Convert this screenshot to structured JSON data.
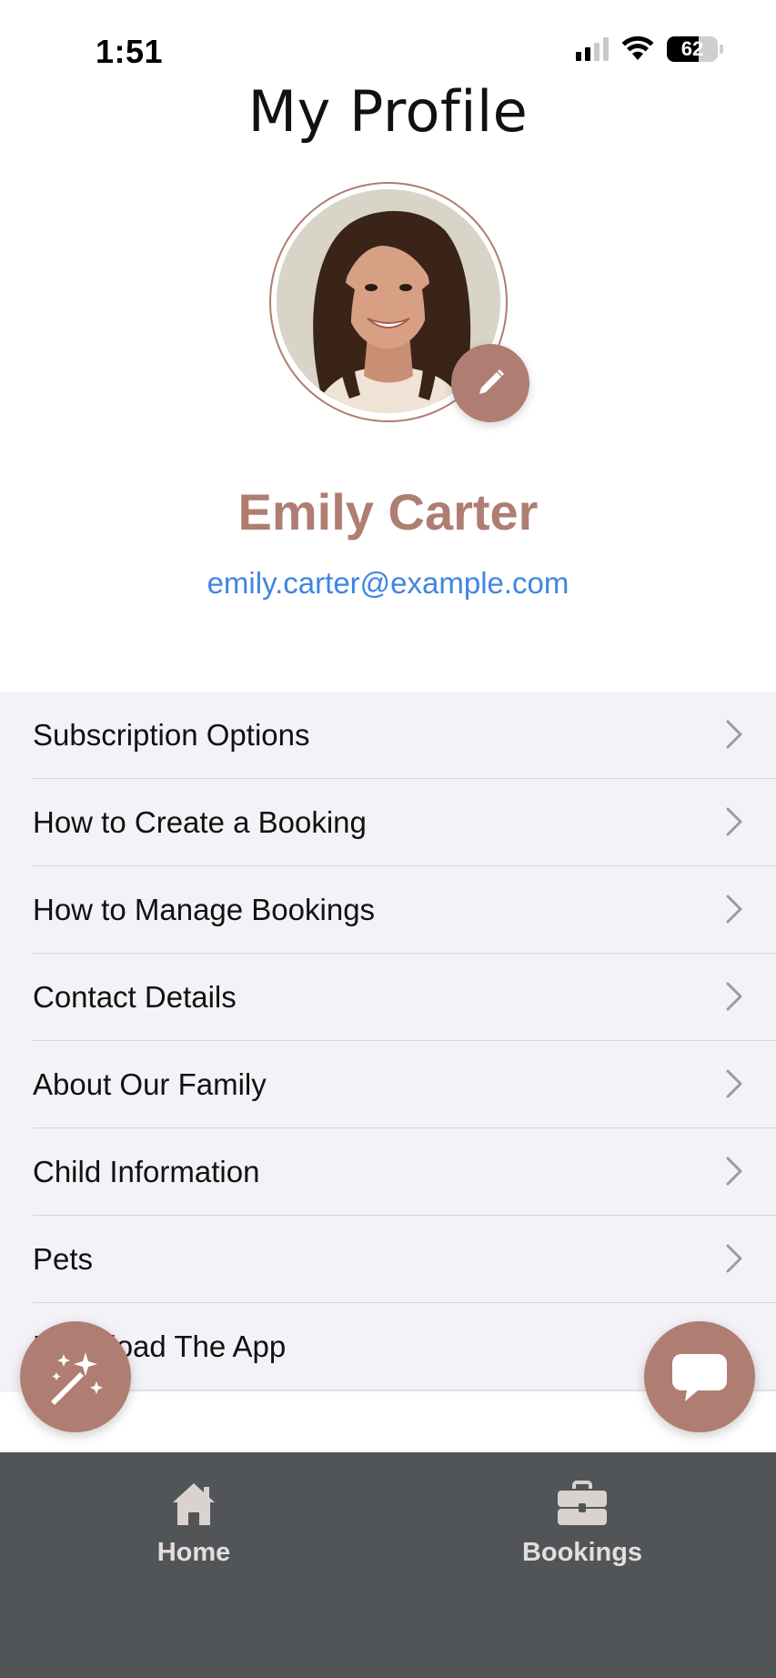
{
  "status_bar": {
    "time": "1:51",
    "battery_level": "62",
    "battery_fraction": 0.62,
    "icons": [
      "signal-icon",
      "wifi-icon",
      "battery-icon"
    ]
  },
  "header": {
    "title": "My Profile"
  },
  "profile": {
    "name": "Emily Carter",
    "email": "emily.carter@example.com",
    "avatar_icon": "profile-photo",
    "edit_icon": "pencil-icon"
  },
  "menu": {
    "items": [
      {
        "label": "Subscription Options"
      },
      {
        "label": "How to Create a Booking"
      },
      {
        "label": "How to Manage Bookings"
      },
      {
        "label": "Contact Details"
      },
      {
        "label": "About Our Family"
      },
      {
        "label": "Child Information"
      },
      {
        "label": "Pets"
      },
      {
        "label": "Download The App"
      }
    ]
  },
  "floating_buttons": {
    "left_icon": "magic-wand-icon",
    "right_icon": "chat-icon"
  },
  "tab_bar": {
    "tabs": [
      {
        "label": "Home",
        "icon": "home-icon"
      },
      {
        "label": "Bookings",
        "icon": "briefcase-icon"
      }
    ]
  },
  "colors": {
    "accent": "#b07d72",
    "link": "#3f86e2",
    "tab_bar": "#525558",
    "list_bg": "#f2f2f7"
  }
}
